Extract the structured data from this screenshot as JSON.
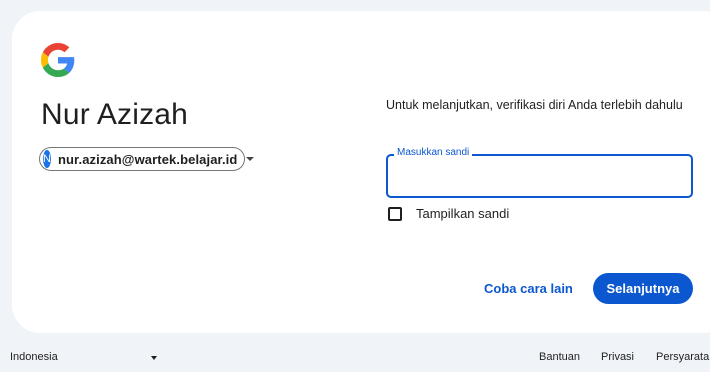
{
  "logo_icon": "google-g-icon",
  "account": {
    "name": "Nur Azizah",
    "avatar_initial": "N",
    "email": "nur.azizah@wartek.belajar.id",
    "avatar_color": "#1a73e8"
  },
  "subtitle": "Untuk melanjutkan, verifikasi diri Anda terlebih dahulu",
  "password": {
    "label": "Masukkan sandi",
    "value": ""
  },
  "show_password": {
    "label": "Tampilkan sandi",
    "checked": false
  },
  "actions": {
    "try_another": "Coba cara lain",
    "next": "Selanjutnya"
  },
  "footer": {
    "language": "Indonesia",
    "links": [
      "Bantuan",
      "Privasi",
      "Persyaratan"
    ]
  },
  "colors": {
    "accent": "#0b57d0",
    "background": "#f0f4f9"
  }
}
